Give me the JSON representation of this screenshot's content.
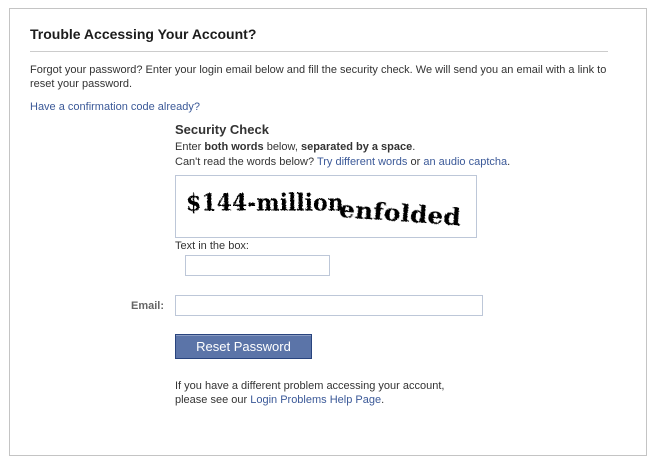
{
  "page": {
    "title": "Trouble Accessing Your Account?",
    "intro": "Forgot your password? Enter your login email below and fill the security check. We will send you an email with a link to reset your password.",
    "confirmation_link": "Have a confirmation code already?"
  },
  "security_check": {
    "heading": "Security Check",
    "instr_enter": "Enter ",
    "instr_both_words": "both words",
    "instr_below": " below, ",
    "instr_separated": "separated by a space",
    "instr_end": ".",
    "cant_read": "Can't read the words below? ",
    "try_different_link": "Try different words",
    "or_text": " or ",
    "audio_link": "an audio captcha",
    "cant_read_end": ".",
    "captcha_word_1": "$144-million",
    "captcha_word_2": "enfolded",
    "text_box_label": "Text in the box:",
    "text_box_value": ""
  },
  "form": {
    "email_label": "Email:",
    "email_value": "",
    "reset_button": "Reset Password"
  },
  "footer": {
    "line1": "If you have a different problem accessing your account,",
    "line2_prefix": "please see our ",
    "help_link": "Login Problems Help Page",
    "line2_suffix": "."
  },
  "colors": {
    "link": "#3b5998",
    "button_bg": "#5b74a8",
    "input_border": "#bdc7d8"
  }
}
